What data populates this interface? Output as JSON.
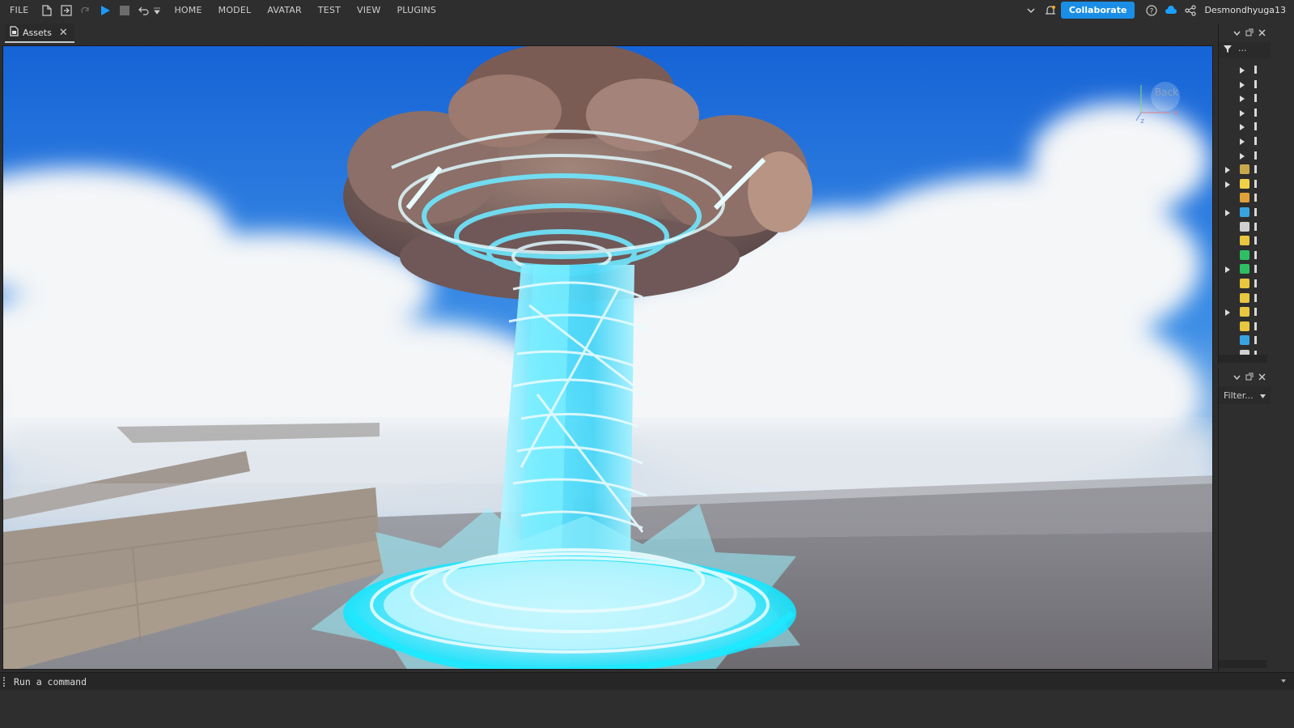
{
  "menubar": {
    "file": "FILE",
    "items": [
      "HOME",
      "MODEL",
      "AVATAR",
      "TEST",
      "VIEW",
      "PLUGINS"
    ],
    "collaborate": "Collaborate",
    "username": "Desmondhyuga13"
  },
  "tabs": [
    {
      "label": "Assets",
      "close": "✕"
    }
  ],
  "viewport": {
    "view_cube_label": "Back",
    "axis_x": "x",
    "axis_z": "z"
  },
  "explorer": {
    "filter_label": "Filter...",
    "tree_row_count": 21
  },
  "command_bar": {
    "placeholder": "Run a command"
  },
  "colors": {
    "accent": "#1a8ee6",
    "sky": "#1f6fd8",
    "energy": "#5fe3ff",
    "cloud_rock": "#7b5c55"
  }
}
